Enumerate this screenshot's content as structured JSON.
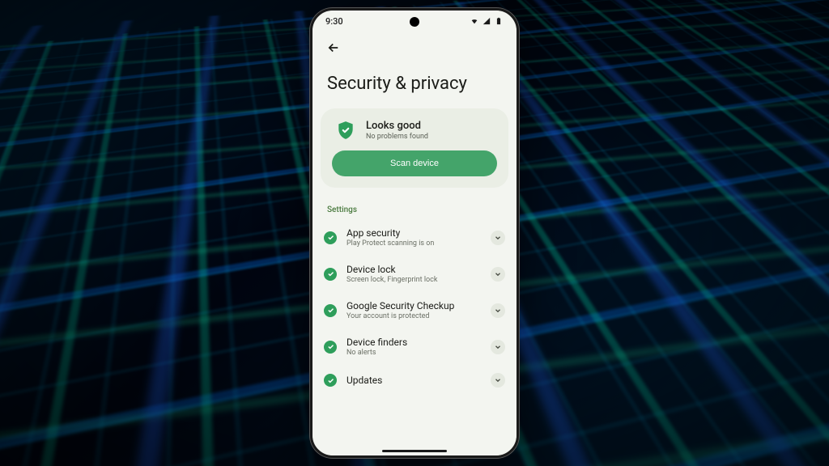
{
  "statusbar": {
    "time": "9:30"
  },
  "page": {
    "title": "Security & privacy"
  },
  "status_card": {
    "title": "Looks good",
    "subtitle": "No problems found",
    "scan_label": "Scan device"
  },
  "section_label": "Settings",
  "items": [
    {
      "title": "App security",
      "subtitle": "Play Protect scanning is on"
    },
    {
      "title": "Device lock",
      "subtitle": "Screen lock, Fingerprint lock"
    },
    {
      "title": "Google Security Checkup",
      "subtitle": "Your account is protected"
    },
    {
      "title": "Device finders",
      "subtitle": "No alerts"
    },
    {
      "title": "Updates",
      "subtitle": ""
    }
  ],
  "colors": {
    "accent": "#2e9e5b",
    "scan_button": "#44a46a"
  }
}
